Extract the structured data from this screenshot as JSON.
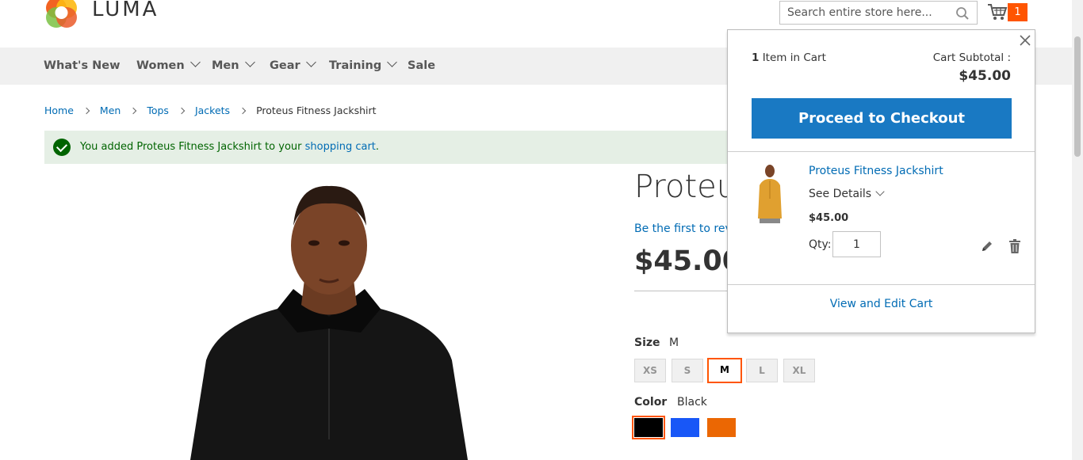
{
  "brand": {
    "name": "LUMA"
  },
  "search": {
    "placeholder": "Search entire store here..."
  },
  "cart": {
    "count": "1"
  },
  "nav": [
    {
      "label": "What's New",
      "dropdown": false
    },
    {
      "label": "Women",
      "dropdown": true
    },
    {
      "label": "Men",
      "dropdown": true
    },
    {
      "label": "Gear",
      "dropdown": true
    },
    {
      "label": "Training",
      "dropdown": true
    },
    {
      "label": "Sale",
      "dropdown": false
    }
  ],
  "breadcrumb": {
    "items": [
      "Home",
      "Men",
      "Tops",
      "Jackets"
    ],
    "current": "Proteus Fitness Jackshirt"
  },
  "message": {
    "text": "You added Proteus Fitness Jackshirt to your ",
    "link": "shopping cart",
    "suffix": "."
  },
  "product": {
    "title": "Proteus Fitness Jackshirt",
    "review_link": "Be the first to review this product",
    "price": "$45.00",
    "size_label": "Size",
    "size_selected": "M",
    "sizes": [
      "XS",
      "S",
      "M",
      "L",
      "XL"
    ],
    "color_label": "Color",
    "color_selected": "Black",
    "colors": [
      {
        "name": "Black",
        "hex": "#000000"
      },
      {
        "name": "Blue",
        "hex": "#1857f7"
      },
      {
        "name": "Orange",
        "hex": "#eb6703"
      }
    ]
  },
  "minicart": {
    "item_count": "1",
    "item_count_label": " Item in Cart",
    "subtotal_label": "Cart Subtotal :",
    "subtotal": "$45.00",
    "checkout_label": "Proceed to Checkout",
    "item": {
      "name": "Proteus Fitness Jackshirt",
      "details_label": "See Details",
      "price": "$45.00",
      "qty_label": "Qty:",
      "qty": "1"
    },
    "view_cart_label": "View and Edit Cart"
  },
  "colors": {
    "accent_blue": "#1979c3",
    "link_blue": "#006bb4",
    "cart_badge": "#ff5501",
    "success_bg": "#e5efe5",
    "success_text": "#006400"
  }
}
